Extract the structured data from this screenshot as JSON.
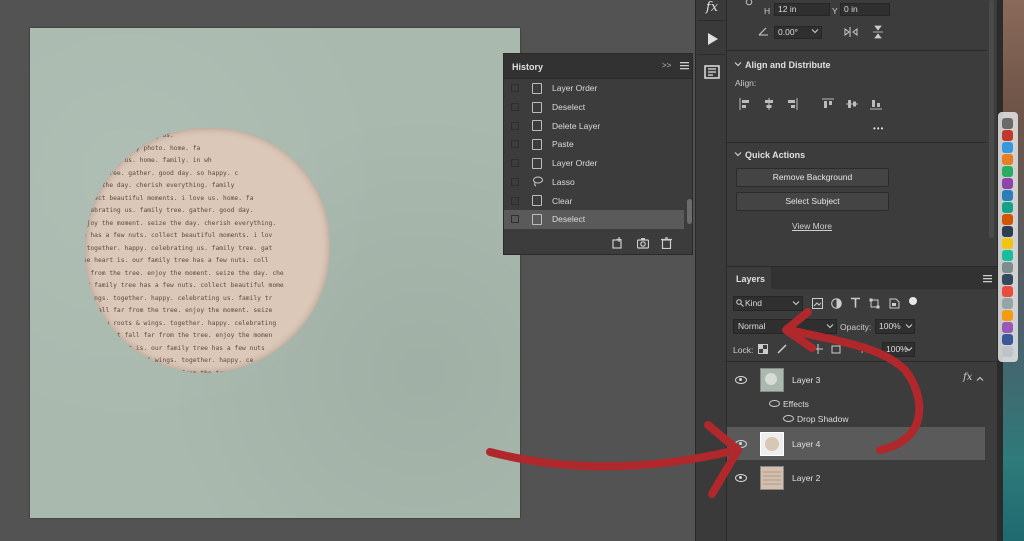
{
  "canvas": {
    "hole_text_lines": [
      "es. happy celebrating us.",
      "r. happy. family photo. home. fa",
      "ree. i love us. home. family. in wh",
      "family tree. gather. good day. so happy. c",
      "seize the day. cherish everything. family",
      "collect beautiful moments. i love us. home. fa",
      "celebrating us. family tree. gather. good day.",
      "enjoy the moment. seize the day. cherish everything.",
      "he has a few nuts. collect beautiful moments. i lov",
      ". together. happy. celebrating us. family tree. gat",
      "the heart is. our family tree has a few nuts. coll",
      "ar from the tree. enjoy the moment. seize the day. che",
      "our family tree has a few nuts. collect beautiful mome",
      "& wings. together. happy. celebrating us. family tr",
      "n't fall far from the tree. enjoy the moment. seize",
      "ives you roots & wings. together. happy. celebrating",
      "ple doesn't fall far from the tree. enjoy the momen",
      "here the heart is. our family tree has a few nuts",
      "y gives you roots & wings. together. happy. ce",
      "the apple doesn't fall far from the tree. en",
      "is where the heart is. our family tree h",
      ". family gives you roots & wings. to",
      "the apple doesn't fall far fro",
      "me is where the heart is."
    ]
  },
  "history": {
    "title": "History",
    "items": [
      {
        "label": "Layer Order"
      },
      {
        "label": "Deselect"
      },
      {
        "label": "Delete Layer"
      },
      {
        "label": "Paste"
      },
      {
        "label": "Layer Order"
      },
      {
        "label": "Lasso"
      },
      {
        "label": "Clear"
      },
      {
        "label": "Deselect"
      }
    ],
    "selected_index": 7,
    "expand_label": ">>"
  },
  "toolbar": {
    "fx_label": "fx"
  },
  "properties": {
    "h_label": "H",
    "h_value": "12 in",
    "y_label": "Y",
    "y_value": "0 in",
    "angle_value": "0.00°"
  },
  "align": {
    "title": "Align and Distribute",
    "align_label": "Align:",
    "more": "•••"
  },
  "quick_actions": {
    "title": "Quick Actions",
    "remove_bg": "Remove Background",
    "select_subject": "Select Subject",
    "view_more": "View More"
  },
  "layers": {
    "title": "Layers",
    "kind_label": "Kind",
    "blend_mode": "Normal",
    "opacity_label": "Opacity:",
    "opacity_value": "100%",
    "lock_label": "Lock:",
    "fill_label": "Fill:",
    "fill_value": "100%",
    "items": [
      {
        "name": "Layer 3",
        "fx": "fx"
      },
      {
        "name": "Layer 4"
      },
      {
        "name": "Layer 2"
      }
    ],
    "effects_label": "Effects",
    "drop_shadow_label": "Drop Shadow"
  },
  "colors": {
    "annotation_arrow": "#b0282c",
    "doc_bg": "#a9b9ae",
    "hole_paper": "#dcc8b8"
  }
}
